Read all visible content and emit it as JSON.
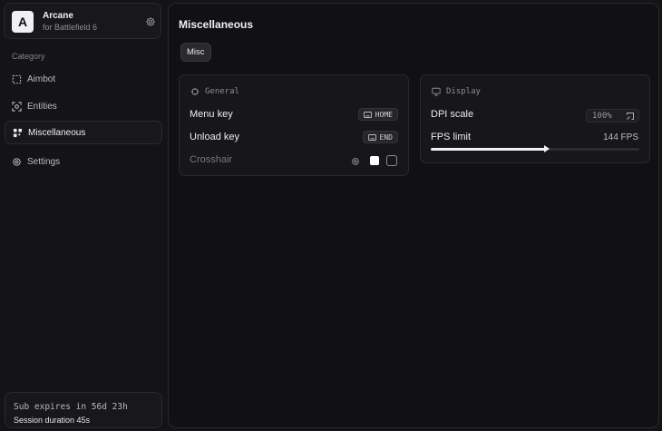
{
  "brand": {
    "logo_letter": "A",
    "name": "Arcane",
    "subtitle": "for Battlefield 6",
    "settings_icon": "gear-icon"
  },
  "sidebar": {
    "category_label": "Category",
    "items": [
      {
        "label": "Aimbot",
        "icon": "crosshair-dashed-icon",
        "active": false
      },
      {
        "label": "Entities",
        "icon": "scan-icon",
        "active": false
      },
      {
        "label": "Miscellaneous",
        "icon": "grid-icon",
        "active": true
      },
      {
        "label": "Settings",
        "icon": "gear-icon",
        "active": false
      }
    ]
  },
  "footer": {
    "subscription": "Sub expires in 56d 23h",
    "session": "Session duration 45s"
  },
  "main": {
    "title": "Miscellaneous",
    "tabs": [
      {
        "label": "Misc",
        "active": true
      }
    ]
  },
  "general": {
    "header": "General",
    "rows": {
      "menu_key": {
        "label": "Menu key",
        "key": "HOME"
      },
      "unload_key": {
        "label": "Unload key",
        "key": "END"
      },
      "crosshair": {
        "label": "Crosshair",
        "color": "#ffffff",
        "enabled": false
      }
    }
  },
  "display": {
    "header": "Display",
    "dpi": {
      "label": "DPI scale",
      "value": "100%"
    },
    "fps": {
      "label": "FPS limit",
      "value": "144 FPS",
      "slider_fraction": 0.55
    }
  },
  "colors": {
    "background": "#141416",
    "panel": "#17171a",
    "accent": "#f2f2f4"
  }
}
